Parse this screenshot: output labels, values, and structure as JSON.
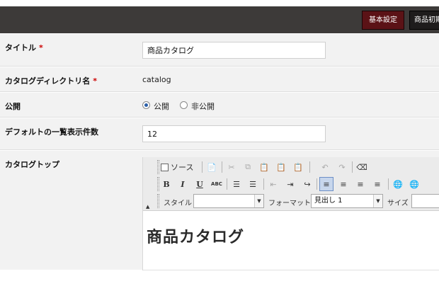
{
  "top_tabs": [
    {
      "label": "基本設定"
    },
    {
      "label": "商品初期"
    }
  ],
  "form": {
    "title": {
      "label": "タイトル",
      "required_mark": "*",
      "value": "商品カタログ"
    },
    "directory": {
      "label": "カタログディレクトリ名",
      "required_mark": "*",
      "value": "catalog"
    },
    "publish": {
      "label": "公開",
      "options": [
        "公開",
        "非公開"
      ],
      "selected": "公開"
    },
    "per_page": {
      "label": "デフォルトの一覧表示件数",
      "value": "12"
    },
    "top": {
      "label": "カタログトップ"
    }
  },
  "editor": {
    "source_label": "ソース",
    "style_label": "スタイル",
    "style_value": "",
    "format_label": "フォーマット",
    "format_value": "見出し 1",
    "size_label": "サイズ",
    "size_value": "",
    "content_heading": "商品カタログ"
  }
}
